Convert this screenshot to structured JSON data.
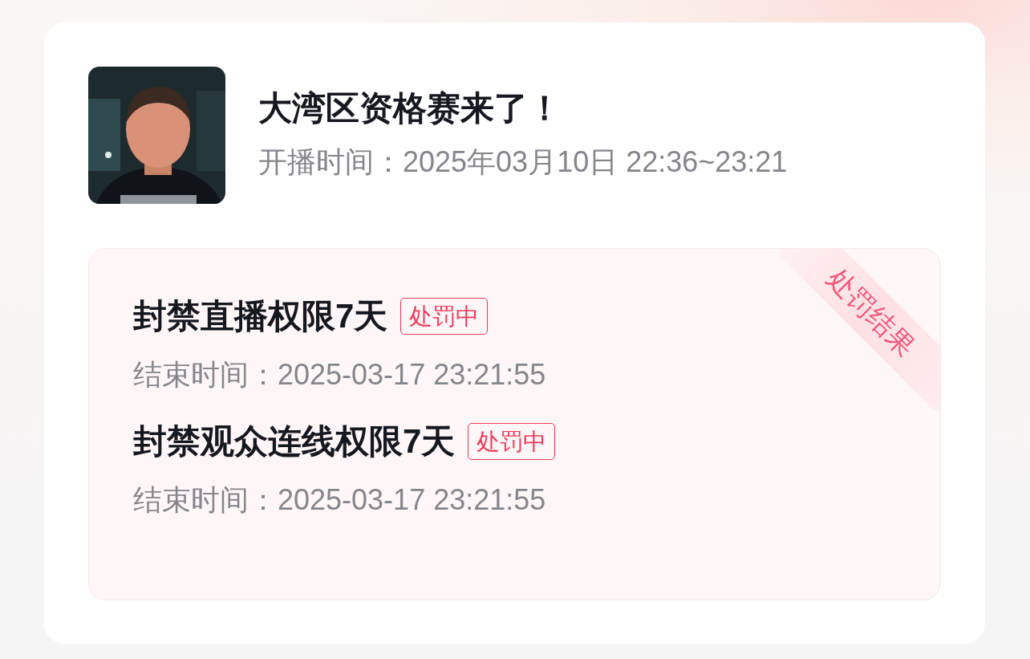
{
  "live": {
    "title": "大湾区资格赛来了！",
    "start_time": "开播时间：2025年03月10日 22:36~23:21"
  },
  "penalty": {
    "ribbon": "处罚结果",
    "items": [
      {
        "title": "封禁直播权限7天",
        "status": "处罚中",
        "end_time": "结束时间：2025-03-17 23:21:55"
      },
      {
        "title": "封禁观众连线权限7天",
        "status": "处罚中",
        "end_time": "结束时间：2025-03-17 23:21:55"
      }
    ]
  }
}
